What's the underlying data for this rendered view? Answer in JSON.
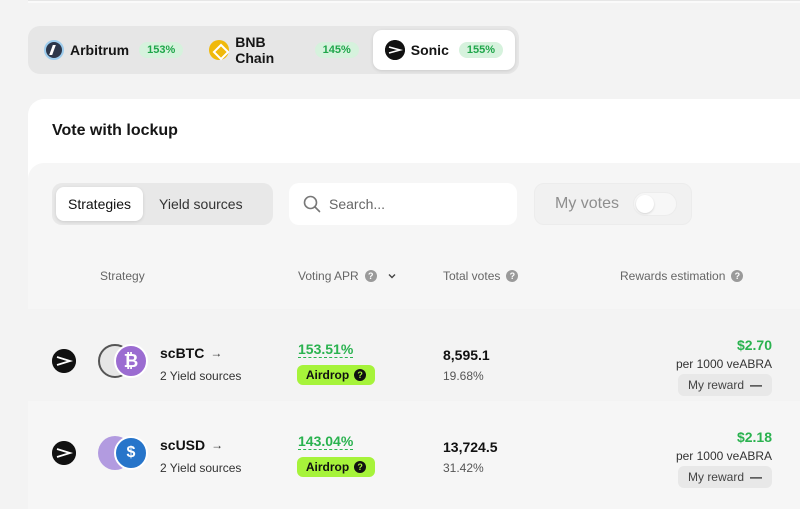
{
  "chains": [
    {
      "name": "Arbitrum",
      "apr": "153%",
      "icon": "arbitrum-icon"
    },
    {
      "name": "BNB Chain",
      "apr": "145%",
      "icon": "bnb-icon"
    },
    {
      "name": "Sonic",
      "apr": "155%",
      "icon": "sonic-icon",
      "active": true
    }
  ],
  "card": {
    "title": "Vote with lockup"
  },
  "filters": {
    "tabs": [
      "Strategies",
      "Yield sources"
    ],
    "search_placeholder": "Search...",
    "my_votes_label": "My votes"
  },
  "table": {
    "headers": {
      "strategy": "Strategy",
      "voting_apr": "Voting APR",
      "total_votes": "Total votes",
      "rewards": "Rewards estimation"
    },
    "rows": [
      {
        "name": "scBTC",
        "sources": "2 Yield sources",
        "apr": "153.51%",
        "badge": "Airdrop",
        "votes": "8,595.1",
        "votes_pct": "19.68%",
        "reward": "$2.70",
        "per": "per 1000 veABRA",
        "my_reward": "My reward"
      },
      {
        "name": "scUSD",
        "sources": "2 Yield sources",
        "apr": "143.04%",
        "badge": "Airdrop",
        "votes": "13,724.5",
        "votes_pct": "31.42%",
        "reward": "$2.18",
        "per": "per 1000 veABRA",
        "my_reward": "My reward"
      }
    ]
  },
  "colors": {
    "accent_green": "#2ab24f",
    "airdrop_badge": "#a6f33a"
  }
}
